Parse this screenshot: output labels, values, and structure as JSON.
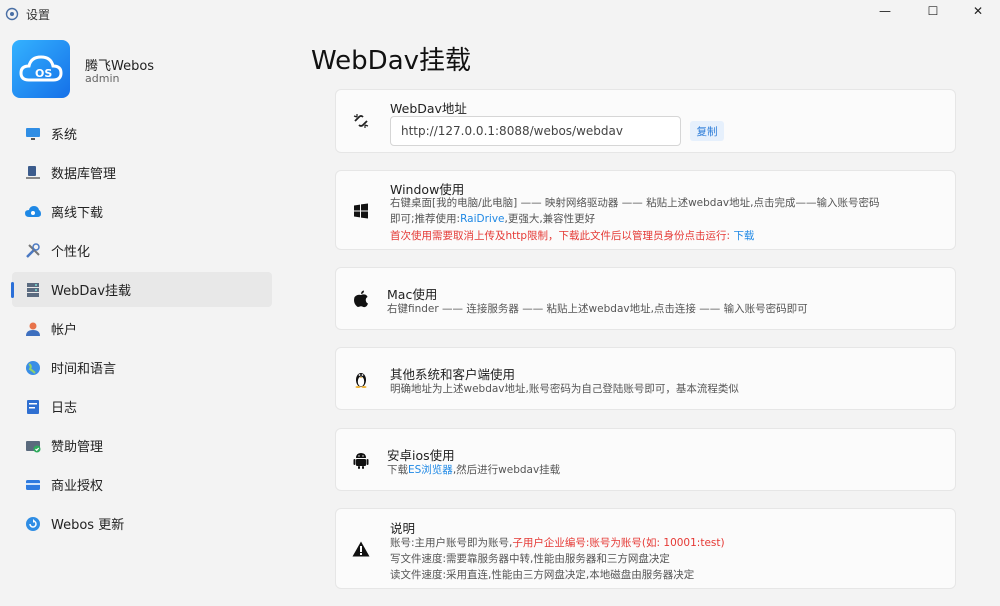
{
  "window": {
    "title": "设置",
    "minimize_glyph": "—",
    "maximize_glyph": "☐",
    "close_glyph": "✕"
  },
  "profile": {
    "name": "腾飞Webos",
    "user": "admin",
    "logo_text": "OS"
  },
  "nav": {
    "items": [
      {
        "label": "系统",
        "icon": "monitor-icon"
      },
      {
        "label": "数据库管理",
        "icon": "database-icon"
      },
      {
        "label": "离线下载",
        "icon": "cloud-download-icon"
      },
      {
        "label": "个性化",
        "icon": "tools-icon"
      },
      {
        "label": "WebDav挂载",
        "icon": "server-icon",
        "active": true
      },
      {
        "label": "帐户",
        "icon": "user-icon"
      },
      {
        "label": "时间和语言",
        "icon": "globe-icon"
      },
      {
        "label": "日志",
        "icon": "log-icon"
      },
      {
        "label": "赞助管理",
        "icon": "sponsor-icon"
      },
      {
        "label": "商业授权",
        "icon": "card-icon"
      },
      {
        "label": "Webos 更新",
        "icon": "update-icon"
      }
    ]
  },
  "page_title": "WebDav挂载",
  "webdav": {
    "title": "WebDav地址",
    "url": "http://127.0.0.1:8088/webos/webdav",
    "copy_label": "复制"
  },
  "windows": {
    "title": "Window使用",
    "line1": "右键桌面[我的电脑/此电脑] —— 映射网络驱动器 —— 粘贴上述webdav地址,点击完成——输入账号密码",
    "line2_prefix": "即可;推荐使用:",
    "line2_link": "RaiDrive",
    "line2_suffix": ",更强大,兼容性更好",
    "line3": "首次使用需要取消上传及http限制，下载此文件后以管理员身份点击运行: ",
    "line3_link": "下载"
  },
  "mac": {
    "title": "Mac使用",
    "line1": "右键finder —— 连接服务器 —— 粘贴上述webdav地址,点击连接 —— 输入账号密码即可"
  },
  "other": {
    "title": "其他系统和客户端使用",
    "line1": "明确地址为上述webdav地址,账号密码为自己登陆账号即可，基本流程类似"
  },
  "android": {
    "title": "安卓ios使用",
    "line1_prefix": "下载",
    "line1_link": "ES浏览器",
    "line1_suffix": ",然后进行webdav挂载"
  },
  "notes": {
    "title": "说明",
    "line1_prefix": "账号:主用户账号即为账号,",
    "line1_red": "子用户企业编号:账号为账号(如: 10001:test)",
    "line2": "写文件速度:需要靠服务器中转,性能由服务器和三方网盘决定",
    "line3": "读文件速度:采用直连,性能由三方网盘决定,本地磁盘由服务器决定"
  },
  "colors": {
    "accent": "#2b6fd8",
    "link": "#1e88e5",
    "warning": "#e53935"
  }
}
